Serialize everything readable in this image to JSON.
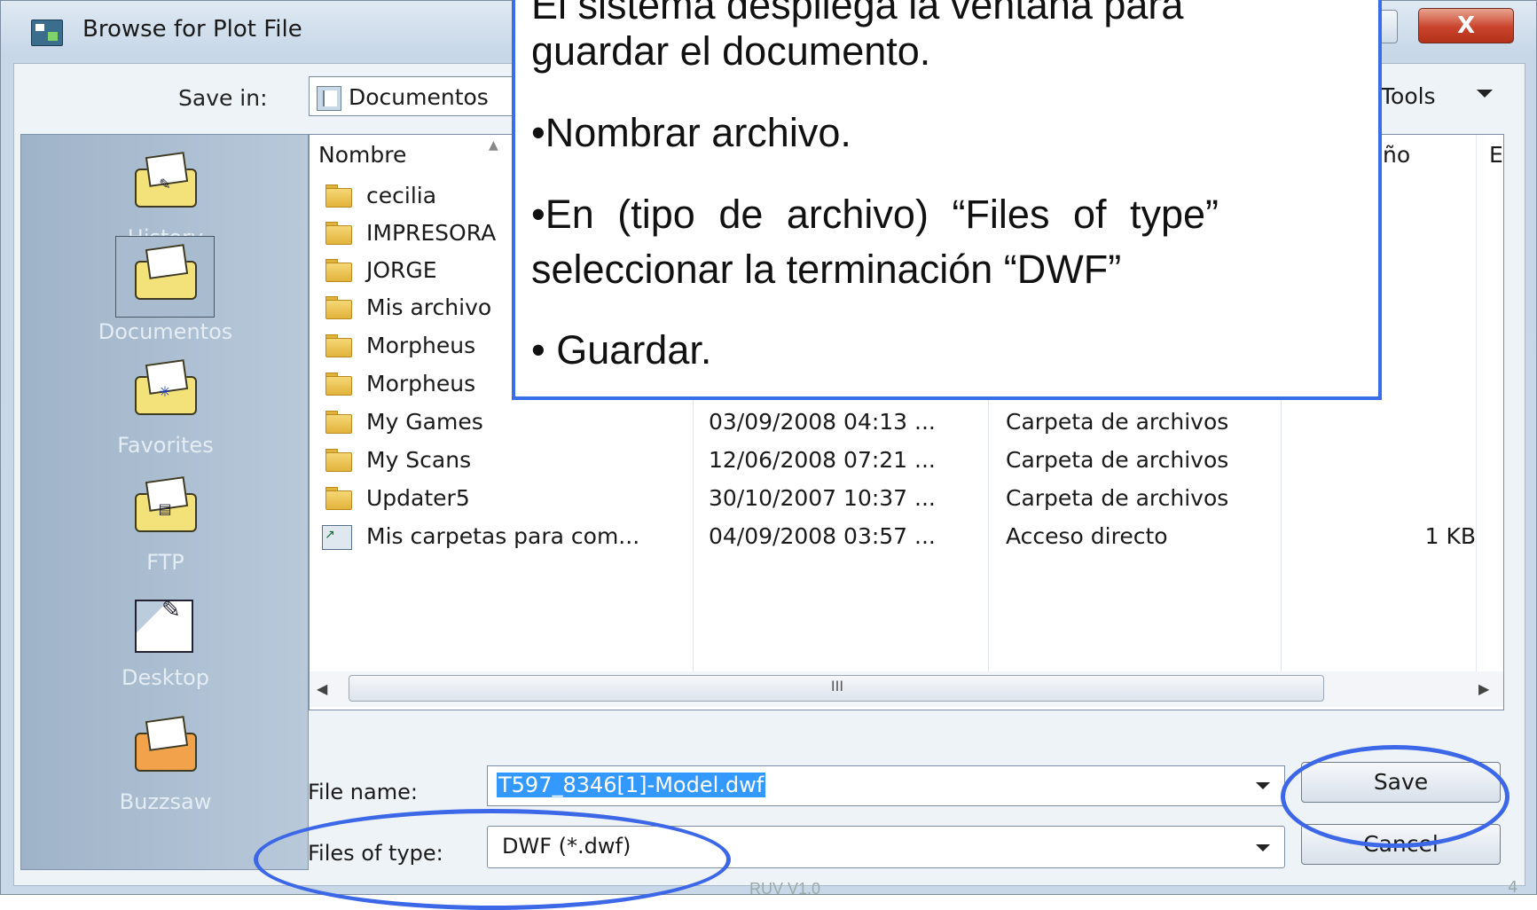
{
  "window": {
    "title": "Browse for Plot File",
    "help_glyph": "?",
    "close_glyph": "X"
  },
  "toolbar": {
    "save_in_label": "Save in:",
    "save_in_value": "Documentos",
    "tools_label": "Tools"
  },
  "places": [
    {
      "label": "History",
      "icon": "history-folder-icon"
    },
    {
      "label": "Documentos",
      "icon": "documents-folder-icon",
      "selected": true
    },
    {
      "label": "Favorites",
      "icon": "favorites-folder-icon"
    },
    {
      "label": "FTP",
      "icon": "ftp-folder-icon"
    },
    {
      "label": "Desktop",
      "icon": "desktop-icon"
    },
    {
      "label": "Buzzsaw",
      "icon": "buzzsaw-folder-icon"
    }
  ],
  "file_list": {
    "columns": {
      "name": "Nombre",
      "size": "ño",
      "extra": "E"
    },
    "rows": [
      {
        "name": "cecilia",
        "date": "",
        "type": "",
        "size": "",
        "icon": "folder-icon"
      },
      {
        "name": "IMPRESORA",
        "date": "",
        "type": "",
        "size": "",
        "icon": "folder-icon"
      },
      {
        "name": "JORGE",
        "date": "",
        "type": "",
        "size": "",
        "icon": "folder-icon"
      },
      {
        "name": "Mis archivo",
        "date": "",
        "type": "",
        "size": "",
        "icon": "folder-icon"
      },
      {
        "name": "Morpheus",
        "date": "",
        "type": "",
        "size": "",
        "icon": "folder-icon"
      },
      {
        "name": "Morpheus",
        "date": "",
        "type": "",
        "size": "",
        "icon": "folder-icon"
      },
      {
        "name": "My Games",
        "date": "03/09/2008 04:13 ...",
        "type": "Carpeta de archivos",
        "size": "",
        "icon": "folder-icon"
      },
      {
        "name": "My Scans",
        "date": "12/06/2008 07:21 ...",
        "type": "Carpeta de archivos",
        "size": "",
        "icon": "folder-icon"
      },
      {
        "name": "Updater5",
        "date": "30/10/2007 10:37 ...",
        "type": "Carpeta de archivos",
        "size": "",
        "icon": "folder-icon"
      },
      {
        "name": "Mis carpetas para com...",
        "date": "04/09/2008 03:57 ...",
        "type": "Acceso directo",
        "size": "1 KB",
        "icon": "shortcut-icon"
      }
    ],
    "scroll_grip": "III"
  },
  "form": {
    "file_name_label": "File name:",
    "file_name_value": "T597_8346[1]-Model.dwf",
    "files_of_type_label": "Files of type:",
    "files_of_type_value": "DWF (*.dwf)",
    "save_label": "Save",
    "cancel_label": "Cancel"
  },
  "callout": {
    "line0": "El sistema despliega la ventana para",
    "line1": "guardar el documento.",
    "line2": "•Nombrar archivo.",
    "line3": "•En  (tipo de archivo) “Files of type”",
    "line4": "seleccionar la terminación “DWF”",
    "line5": "• Guardar."
  },
  "footer": {
    "text": "RUV V1.0",
    "page": "4"
  },
  "colors": {
    "annotation_blue": "#3a6ee6",
    "selection_blue": "#3399ff",
    "close_red": "#c9432c"
  }
}
